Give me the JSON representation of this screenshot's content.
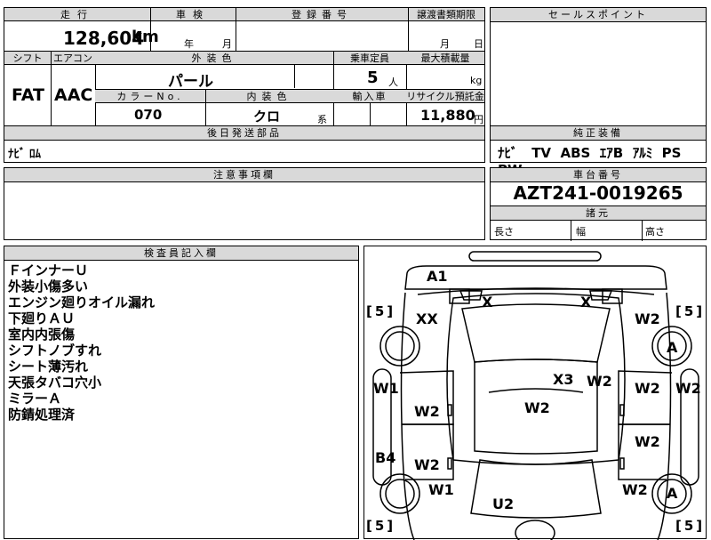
{
  "top": {
    "mileage_label": "走行",
    "mileage_value": "128,604",
    "mileage_unit": "km",
    "inspection_label": "車検",
    "inspection_year": "年",
    "inspection_month": "月",
    "registration_label": "登録番号",
    "transfer_label": "譲渡書類期限",
    "transfer_month": "月",
    "transfer_day": "日"
  },
  "spec": {
    "shift_label": "シフト",
    "shift_value": "FAT",
    "ac_label": "エアコン",
    "ac_value": "AAC",
    "exterior_label": "外装色",
    "exterior_value": "パール",
    "capacity_label": "乗車定員",
    "capacity_value": "5",
    "capacity_unit": "人",
    "load_label": "最大積載量",
    "load_unit": "kg",
    "color_no_label": "カラーNo.",
    "color_no_value": "070",
    "interior_label": "内装色",
    "interior_value": "クロ",
    "interior_suffix": "系",
    "import_label": "輸入車",
    "recycle_label": "リサイクル預託金",
    "recycle_value": "11,880",
    "recycle_unit": "円"
  },
  "shipping": {
    "label": "後日発送部品",
    "value": "ﾅﾋﾞ ﾛﾑ"
  },
  "sales_point": {
    "label": "セールスポイント"
  },
  "equipment": {
    "label": "純正装備",
    "items": [
      "ﾅﾋﾞ",
      "TV",
      "ABS",
      "ｴｱB",
      "ｱﾙﾐ",
      "PS",
      "PW"
    ]
  },
  "caution": {
    "label": "注意事項欄"
  },
  "chassis": {
    "label": "車台番号",
    "value": "AZT241-0019265",
    "dims_label": "諸元",
    "length_label": "長さ",
    "width_label": "幅",
    "height_label": "高さ"
  },
  "inspector": {
    "label": "検査員記入欄",
    "lines": [
      "ＦインナーＵ",
      "外装小傷多い",
      "エンジン廻りオイル漏れ",
      "下廻りＡＵ",
      "室内内張傷",
      "シフトノブすれ",
      "シート薄汚れ",
      "天張タバコ穴小",
      "ミラーＡ",
      "防錆処理済"
    ]
  },
  "diagram": {
    "marks": {
      "a1": "A1",
      "x_left": "X",
      "x_right": "X",
      "xx": "XX",
      "w2_fr": "W2",
      "tire_fr": "A",
      "w1_left": "W1",
      "x3": "X3",
      "w2_center_top": "W2",
      "w2_rfdoor": "W2",
      "w2_right_side": "W2",
      "w2_lfdoor": "W2",
      "w2_roof": "W2",
      "w2_rrdoor": "W2",
      "b4": "B4",
      "w2_lrdoor": "W2",
      "w1_rl": "W1",
      "w2_rr": "W2",
      "tire_rr": "A",
      "u2": "U2"
    },
    "tread": {
      "fl": "5",
      "fr": "5",
      "rl": "5",
      "rr": "5"
    }
  }
}
